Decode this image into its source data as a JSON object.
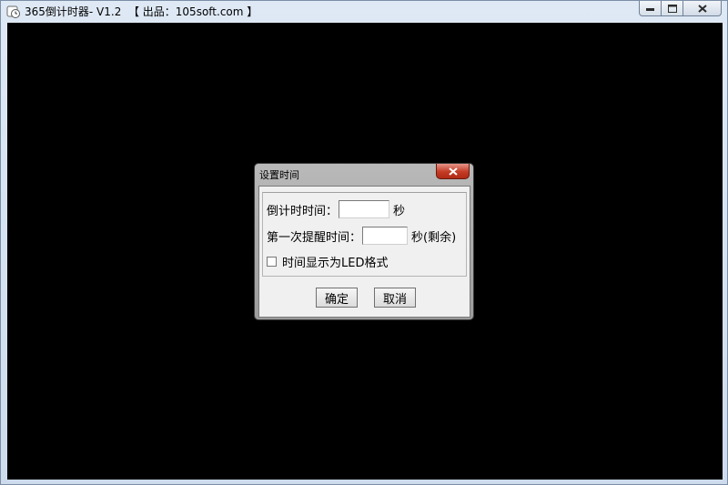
{
  "window": {
    "title": "365倒计时器- V1.2  【 出品：105soft.com 】",
    "icons": {
      "app": "clock-icon",
      "minimize": "minimize-icon",
      "maximize": "maximize-icon",
      "close": "close-icon"
    }
  },
  "dialog": {
    "title": "设置时间",
    "countdown_label": "倒计时时间：",
    "countdown_value": "",
    "countdown_unit": "秒",
    "reminder_label": "第一次提醒时间：",
    "reminder_value": "",
    "reminder_unit": "秒(剩余)",
    "led_label": "时间显示为LED格式",
    "led_checked": false,
    "ok_label": "确定",
    "cancel_label": "取消"
  },
  "colors": {
    "content_bg": "#000000",
    "dialog_close": "#c43b24",
    "window_frame": "#cddbed"
  }
}
